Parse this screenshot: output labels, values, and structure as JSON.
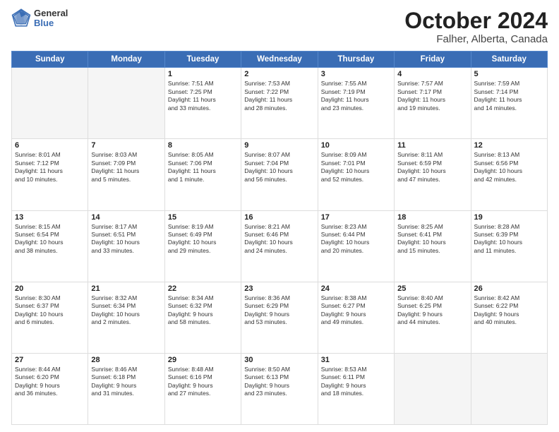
{
  "header": {
    "logo_line1": "General",
    "logo_line2": "Blue",
    "title": "October 2024",
    "subtitle": "Falher, Alberta, Canada"
  },
  "weekdays": [
    "Sunday",
    "Monday",
    "Tuesday",
    "Wednesday",
    "Thursday",
    "Friday",
    "Saturday"
  ],
  "weeks": [
    [
      {
        "day": "",
        "info": ""
      },
      {
        "day": "",
        "info": ""
      },
      {
        "day": "1",
        "info": "Sunrise: 7:51 AM\nSunset: 7:25 PM\nDaylight: 11 hours\nand 33 minutes."
      },
      {
        "day": "2",
        "info": "Sunrise: 7:53 AM\nSunset: 7:22 PM\nDaylight: 11 hours\nand 28 minutes."
      },
      {
        "day": "3",
        "info": "Sunrise: 7:55 AM\nSunset: 7:19 PM\nDaylight: 11 hours\nand 23 minutes."
      },
      {
        "day": "4",
        "info": "Sunrise: 7:57 AM\nSunset: 7:17 PM\nDaylight: 11 hours\nand 19 minutes."
      },
      {
        "day": "5",
        "info": "Sunrise: 7:59 AM\nSunset: 7:14 PM\nDaylight: 11 hours\nand 14 minutes."
      }
    ],
    [
      {
        "day": "6",
        "info": "Sunrise: 8:01 AM\nSunset: 7:12 PM\nDaylight: 11 hours\nand 10 minutes."
      },
      {
        "day": "7",
        "info": "Sunrise: 8:03 AM\nSunset: 7:09 PM\nDaylight: 11 hours\nand 5 minutes."
      },
      {
        "day": "8",
        "info": "Sunrise: 8:05 AM\nSunset: 7:06 PM\nDaylight: 11 hours\nand 1 minute."
      },
      {
        "day": "9",
        "info": "Sunrise: 8:07 AM\nSunset: 7:04 PM\nDaylight: 10 hours\nand 56 minutes."
      },
      {
        "day": "10",
        "info": "Sunrise: 8:09 AM\nSunset: 7:01 PM\nDaylight: 10 hours\nand 52 minutes."
      },
      {
        "day": "11",
        "info": "Sunrise: 8:11 AM\nSunset: 6:59 PM\nDaylight: 10 hours\nand 47 minutes."
      },
      {
        "day": "12",
        "info": "Sunrise: 8:13 AM\nSunset: 6:56 PM\nDaylight: 10 hours\nand 42 minutes."
      }
    ],
    [
      {
        "day": "13",
        "info": "Sunrise: 8:15 AM\nSunset: 6:54 PM\nDaylight: 10 hours\nand 38 minutes."
      },
      {
        "day": "14",
        "info": "Sunrise: 8:17 AM\nSunset: 6:51 PM\nDaylight: 10 hours\nand 33 minutes."
      },
      {
        "day": "15",
        "info": "Sunrise: 8:19 AM\nSunset: 6:49 PM\nDaylight: 10 hours\nand 29 minutes."
      },
      {
        "day": "16",
        "info": "Sunrise: 8:21 AM\nSunset: 6:46 PM\nDaylight: 10 hours\nand 24 minutes."
      },
      {
        "day": "17",
        "info": "Sunrise: 8:23 AM\nSunset: 6:44 PM\nDaylight: 10 hours\nand 20 minutes."
      },
      {
        "day": "18",
        "info": "Sunrise: 8:25 AM\nSunset: 6:41 PM\nDaylight: 10 hours\nand 15 minutes."
      },
      {
        "day": "19",
        "info": "Sunrise: 8:28 AM\nSunset: 6:39 PM\nDaylight: 10 hours\nand 11 minutes."
      }
    ],
    [
      {
        "day": "20",
        "info": "Sunrise: 8:30 AM\nSunset: 6:37 PM\nDaylight: 10 hours\nand 6 minutes."
      },
      {
        "day": "21",
        "info": "Sunrise: 8:32 AM\nSunset: 6:34 PM\nDaylight: 10 hours\nand 2 minutes."
      },
      {
        "day": "22",
        "info": "Sunrise: 8:34 AM\nSunset: 6:32 PM\nDaylight: 9 hours\nand 58 minutes."
      },
      {
        "day": "23",
        "info": "Sunrise: 8:36 AM\nSunset: 6:29 PM\nDaylight: 9 hours\nand 53 minutes."
      },
      {
        "day": "24",
        "info": "Sunrise: 8:38 AM\nSunset: 6:27 PM\nDaylight: 9 hours\nand 49 minutes."
      },
      {
        "day": "25",
        "info": "Sunrise: 8:40 AM\nSunset: 6:25 PM\nDaylight: 9 hours\nand 44 minutes."
      },
      {
        "day": "26",
        "info": "Sunrise: 8:42 AM\nSunset: 6:22 PM\nDaylight: 9 hours\nand 40 minutes."
      }
    ],
    [
      {
        "day": "27",
        "info": "Sunrise: 8:44 AM\nSunset: 6:20 PM\nDaylight: 9 hours\nand 36 minutes."
      },
      {
        "day": "28",
        "info": "Sunrise: 8:46 AM\nSunset: 6:18 PM\nDaylight: 9 hours\nand 31 minutes."
      },
      {
        "day": "29",
        "info": "Sunrise: 8:48 AM\nSunset: 6:16 PM\nDaylight: 9 hours\nand 27 minutes."
      },
      {
        "day": "30",
        "info": "Sunrise: 8:50 AM\nSunset: 6:13 PM\nDaylight: 9 hours\nand 23 minutes."
      },
      {
        "day": "31",
        "info": "Sunrise: 8:53 AM\nSunset: 6:11 PM\nDaylight: 9 hours\nand 18 minutes."
      },
      {
        "day": "",
        "info": ""
      },
      {
        "day": "",
        "info": ""
      }
    ]
  ]
}
